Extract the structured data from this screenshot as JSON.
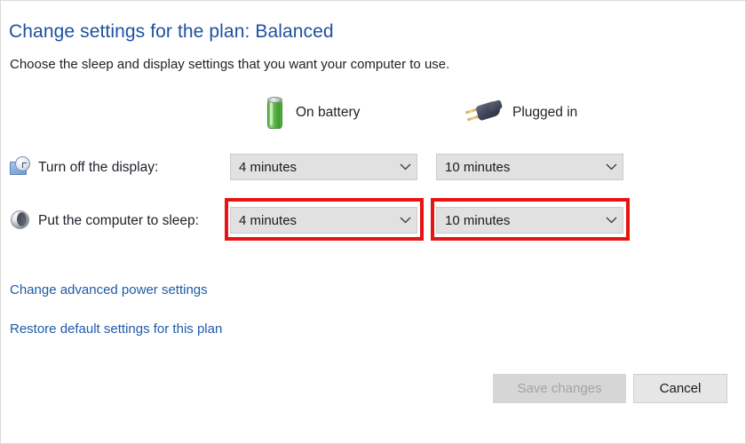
{
  "page": {
    "title": "Change settings for the plan: Balanced",
    "subtitle": "Choose the sleep and display settings that you want your computer to use."
  },
  "columns": [
    {
      "id": "on-battery",
      "label": "On battery",
      "icon": "battery-icon"
    },
    {
      "id": "plugged-in",
      "label": "Plugged in",
      "icon": "power-plug-icon"
    }
  ],
  "rows": [
    {
      "id": "turn-off-display",
      "label": "Turn off the display:",
      "icon": "display-clock-icon",
      "on_battery": "4 minutes",
      "plugged_in": "10 minutes",
      "highlighted": false
    },
    {
      "id": "put-computer-to-sleep",
      "label": "Put the computer to sleep:",
      "icon": "sleep-moon-icon",
      "on_battery": "4 minutes",
      "plugged_in": "10 minutes",
      "highlighted": true
    }
  ],
  "links": [
    {
      "id": "advanced",
      "label": "Change advanced power settings"
    },
    {
      "id": "restore",
      "label": "Restore default settings for this plan"
    }
  ],
  "buttons": {
    "save": {
      "label": "Save changes",
      "enabled": false
    },
    "cancel": {
      "label": "Cancel",
      "enabled": true
    }
  },
  "colors": {
    "title_blue": "#1f50a0",
    "link_blue": "#1f5aa8",
    "highlight_red": "#e81313",
    "control_fill": "#e1e1e1",
    "battery_green": "#55ae3f"
  }
}
